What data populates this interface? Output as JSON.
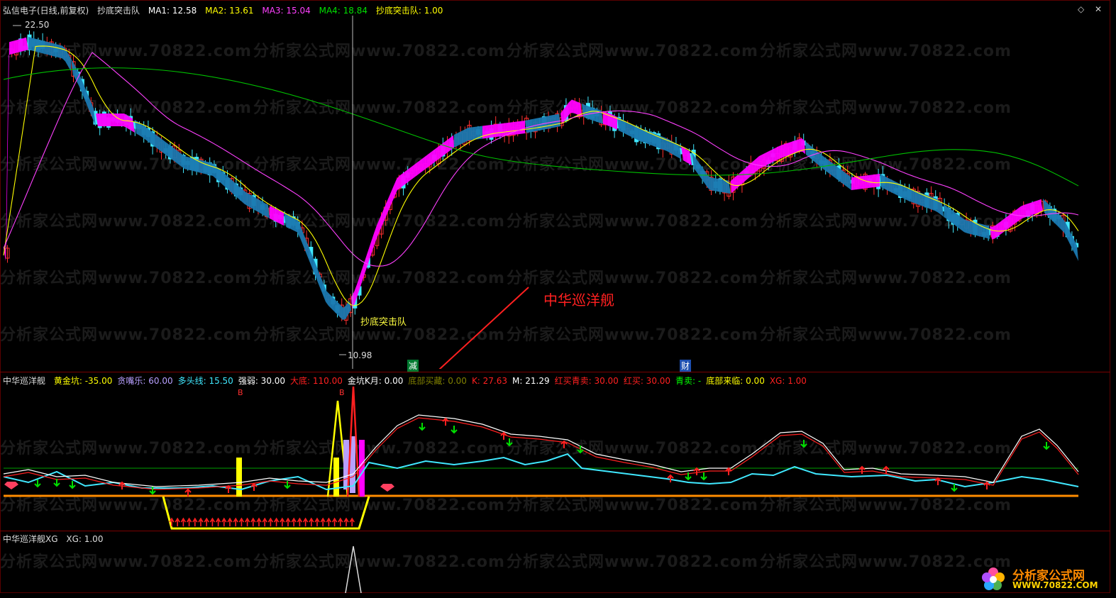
{
  "main_header": {
    "stock": "弘信电子(日线,前复权)",
    "indicator": "抄底突击队",
    "ma1": "MA1: 12.58",
    "ma2": "MA2: 13.61",
    "ma3": "MA3: 15.04",
    "ma4": "MA4: 18.84",
    "signal": "抄底突击队: 1.00"
  },
  "price_labels": {
    "high": "22.50",
    "low": "10.98",
    "signal_label": "抄底突击队",
    "annotation": "中华巡洋舰"
  },
  "event_markers": {
    "jian": "减",
    "cai": "财"
  },
  "sub_header": {
    "name": "中华巡洋舰",
    "items": [
      {
        "label": "黄金坑: -35.00",
        "color": "#ffff00"
      },
      {
        "label": "贪嘴乐: 60.00",
        "color": "#b8a0ff"
      },
      {
        "label": "多头线: 15.50",
        "color": "#40e8ff"
      },
      {
        "label": "强弱: 30.00",
        "color": "#ffffff"
      },
      {
        "label": "大底: 110.00",
        "color": "#ff2020"
      },
      {
        "label": "金坑K月: 0.00",
        "color": "#ffffff"
      },
      {
        "label": "底部买藏: 0.00",
        "color": "#808000"
      },
      {
        "label": "K: 27.63",
        "color": "#ff2020"
      },
      {
        "label": "M: 21.29",
        "color": "#ffffff"
      },
      {
        "label": "红买青卖: 30.00",
        "color": "#ff2020"
      },
      {
        "label": "红买: 30.00",
        "color": "#ff2020"
      },
      {
        "label": "青卖: -",
        "color": "#00ff00"
      },
      {
        "label": "底部来临: 0.00",
        "color": "#ffff00"
      },
      {
        "label": "XG: 1.00",
        "color": "#ff2020"
      }
    ],
    "b_marker": "B"
  },
  "xg_header": {
    "name": "中华巡洋舰XG",
    "value": "XG: 1.00"
  },
  "watermark": "分析家公式网www.70822.com",
  "logo": {
    "title": "分析家公式网",
    "url": "WWW.70822.COM"
  },
  "colors": {
    "up": "#ff3030",
    "down": "#40e8ff",
    "ma1": "#ffffff",
    "ma2": "#ffff00",
    "ma3": "#ff40ff",
    "ma4": "#00c000",
    "band_up": "#ff00ff",
    "band_down": "#1a78b0"
  }
}
